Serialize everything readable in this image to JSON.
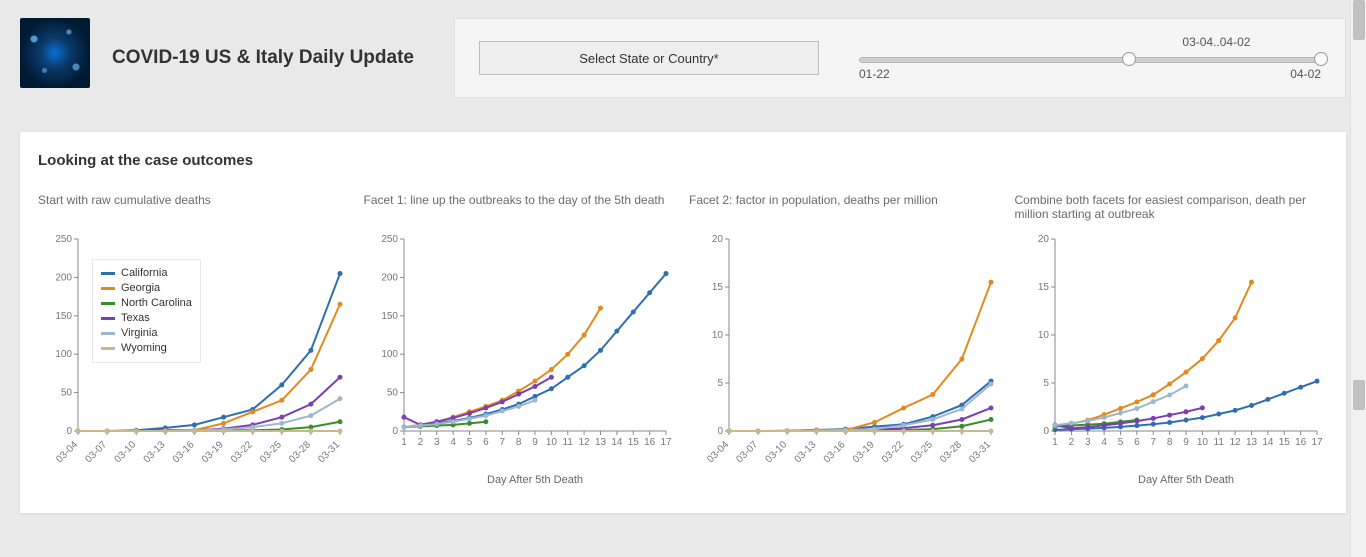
{
  "header": {
    "title": "COVID-19 US & Italy Daily Update"
  },
  "controls": {
    "dropdown_label": "Select State or Country*",
    "slider_min_label": "01-22",
    "slider_max_label": "04-02",
    "slider_range_label": "03-04..04-02"
  },
  "section": {
    "heading": "Looking at the case outcomes"
  },
  "legend": [
    {
      "name": "California",
      "color": "#2e6fb0"
    },
    {
      "name": "Georgia",
      "color": "#e28a1c"
    },
    {
      "name": "North Carolina",
      "color": "#3b8c2b"
    },
    {
      "name": "Texas",
      "color": "#7b3fb3"
    },
    {
      "name": "Virginia",
      "color": "#9db7cd"
    },
    {
      "name": "Wyoming",
      "color": "#c6b88f"
    }
  ],
  "chart_data": [
    {
      "id": "c1",
      "type": "line",
      "title": "Start with raw cumulative deaths",
      "xlabel": "",
      "ylabel": "",
      "ylim": [
        0,
        250
      ],
      "yticks": [
        0,
        50,
        100,
        150,
        200,
        250
      ],
      "x_categories": [
        "03-04",
        "03-07",
        "03-10",
        "03-13",
        "03-16",
        "03-19",
        "03-22",
        "03-25",
        "03-28",
        "03-31"
      ],
      "series": [
        {
          "name": "California",
          "color": "#2e6fb0",
          "values": [
            0,
            0,
            1,
            4,
            8,
            18,
            28,
            60,
            105,
            205
          ]
        },
        {
          "name": "Georgia",
          "color": "#e28a1c",
          "values": [
            0,
            0,
            0,
            1,
            1,
            10,
            25,
            40,
            80,
            165
          ]
        },
        {
          "name": "North Carolina",
          "color": "#3b8c2b",
          "values": [
            0,
            0,
            0,
            0,
            0,
            1,
            1,
            2,
            5,
            12
          ]
        },
        {
          "name": "Texas",
          "color": "#7b3fb3",
          "values": [
            0,
            0,
            0,
            1,
            1,
            3,
            8,
            18,
            35,
            70
          ]
        },
        {
          "name": "Virginia",
          "color": "#9db7cd",
          "values": [
            0,
            0,
            0,
            0,
            1,
            2,
            5,
            10,
            20,
            42
          ]
        },
        {
          "name": "Wyoming",
          "color": "#c6b88f",
          "values": [
            0,
            0,
            0,
            0,
            0,
            0,
            0,
            0,
            0,
            0
          ]
        }
      ]
    },
    {
      "id": "c2",
      "type": "line",
      "title": "Facet 1: line up the outbreaks to the day of the 5th death",
      "xlabel": "Day After 5th Death",
      "ylabel": "",
      "ylim": [
        0,
        250
      ],
      "yticks": [
        0,
        50,
        100,
        150,
        200,
        250
      ],
      "x_categories": [
        "1",
        "2",
        "3",
        "4",
        "5",
        "6",
        "7",
        "8",
        "9",
        "10",
        "11",
        "12",
        "13",
        "14",
        "15",
        "16",
        "17"
      ],
      "series": [
        {
          "name": "California",
          "color": "#2e6fb0",
          "values": [
            5,
            7,
            10,
            13,
            17,
            22,
            28,
            35,
            45,
            55,
            70,
            85,
            105,
            130,
            155,
            180,
            205
          ]
        },
        {
          "name": "Georgia",
          "color": "#e28a1c",
          "values": [
            5,
            8,
            12,
            18,
            25,
            32,
            40,
            52,
            65,
            80,
            100,
            125,
            160
          ]
        },
        {
          "name": "North Carolina",
          "color": "#3b8c2b",
          "values": [
            5,
            6,
            7,
            8,
            10,
            12
          ]
        },
        {
          "name": "Texas",
          "color": "#7b3fb3",
          "values": [
            18,
            8,
            12,
            17,
            23,
            30,
            38,
            48,
            58,
            70
          ]
        },
        {
          "name": "Virginia",
          "color": "#9db7cd",
          "values": [
            5,
            7,
            9,
            12,
            16,
            20,
            26,
            32,
            40
          ]
        }
      ]
    },
    {
      "id": "c3",
      "type": "line",
      "title": "Facet 2: factor in population, deaths per million",
      "xlabel": "",
      "ylabel": "",
      "ylim": [
        0,
        20
      ],
      "yticks": [
        0,
        5,
        10,
        15,
        20
      ],
      "x_categories": [
        "03-04",
        "03-07",
        "03-10",
        "03-13",
        "03-16",
        "03-19",
        "03-22",
        "03-25",
        "03-28",
        "03-31"
      ],
      "series": [
        {
          "name": "California",
          "color": "#2e6fb0",
          "values": [
            0,
            0,
            0.03,
            0.1,
            0.2,
            0.45,
            0.7,
            1.5,
            2.7,
            5.2
          ]
        },
        {
          "name": "Georgia",
          "color": "#e28a1c",
          "values": [
            0,
            0,
            0,
            0.1,
            0.1,
            0.9,
            2.4,
            3.8,
            7.5,
            15.5
          ]
        },
        {
          "name": "North Carolina",
          "color": "#3b8c2b",
          "values": [
            0,
            0,
            0,
            0,
            0,
            0.1,
            0.1,
            0.2,
            0.5,
            1.2
          ]
        },
        {
          "name": "Texas",
          "color": "#7b3fb3",
          "values": [
            0,
            0,
            0,
            0.03,
            0.03,
            0.1,
            0.3,
            0.6,
            1.2,
            2.4
          ]
        },
        {
          "name": "Virginia",
          "color": "#9db7cd",
          "values": [
            0,
            0,
            0,
            0,
            0.1,
            0.2,
            0.6,
            1.2,
            2.3,
            4.9
          ]
        },
        {
          "name": "Wyoming",
          "color": "#c6b88f",
          "values": [
            0,
            0,
            0,
            0,
            0,
            0,
            0,
            0,
            0,
            0
          ]
        }
      ]
    },
    {
      "id": "c4",
      "type": "line",
      "title": "Combine both facets for easiest comparison, death per million starting at outbreak",
      "xlabel": "Day After 5th Death",
      "ylabel": "",
      "ylim": [
        0,
        20
      ],
      "yticks": [
        0,
        5,
        10,
        15,
        20
      ],
      "x_categories": [
        "1",
        "2",
        "3",
        "4",
        "5",
        "6",
        "7",
        "8",
        "9",
        "10",
        "11",
        "12",
        "13",
        "14",
        "15",
        "16",
        "17"
      ],
      "series": [
        {
          "name": "California",
          "color": "#2e6fb0",
          "values": [
            0.13,
            0.18,
            0.25,
            0.33,
            0.43,
            0.56,
            0.71,
            0.89,
            1.14,
            1.39,
            1.77,
            2.15,
            2.66,
            3.29,
            3.93,
            4.56,
            5.19
          ]
        },
        {
          "name": "Georgia",
          "color": "#e28a1c",
          "values": [
            0.47,
            0.75,
            1.13,
            1.7,
            2.36,
            3.02,
            3.77,
            4.9,
            6.13,
            7.54,
            9.42,
            11.78,
            15.5
          ]
        },
        {
          "name": "North Carolina",
          "color": "#3b8c2b",
          "values": [
            0.48,
            0.57,
            0.67,
            0.76,
            0.95,
            1.14
          ]
        },
        {
          "name": "Texas",
          "color": "#7b3fb3",
          "values": [
            0.62,
            0.28,
            0.41,
            0.59,
            0.79,
            1.03,
            1.31,
            1.66,
            2.0,
            2.41
          ]
        },
        {
          "name": "Virginia",
          "color": "#9db7cd",
          "values": [
            0.59,
            0.82,
            1.05,
            1.41,
            1.87,
            2.34,
            3.05,
            3.75,
            4.69
          ]
        }
      ]
    }
  ]
}
